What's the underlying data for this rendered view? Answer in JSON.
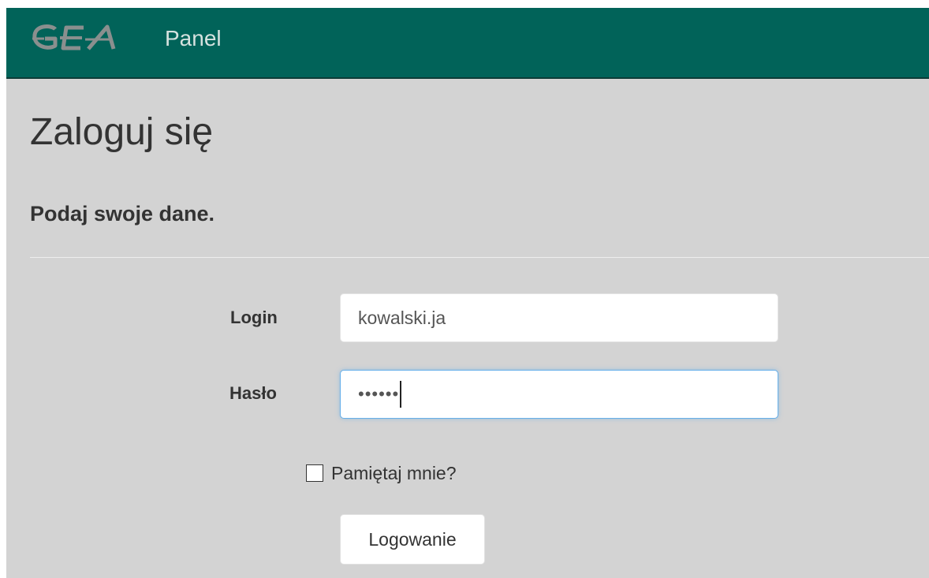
{
  "navbar": {
    "logo_text": "GEA",
    "brand": "Panel",
    "background_color": "#016359"
  },
  "page": {
    "title": "Zaloguj się",
    "subtitle": "Podaj swoje dane."
  },
  "form": {
    "login_label": "Login",
    "login_value": "kowalski.ja",
    "password_label": "Hasło",
    "password_masked": "••••••",
    "remember_label": "Pamiętaj mnie?",
    "remember_checked": false,
    "submit_label": "Logowanie"
  },
  "colors": {
    "background": "#d3d3d3",
    "focus_border": "#66afe9"
  }
}
